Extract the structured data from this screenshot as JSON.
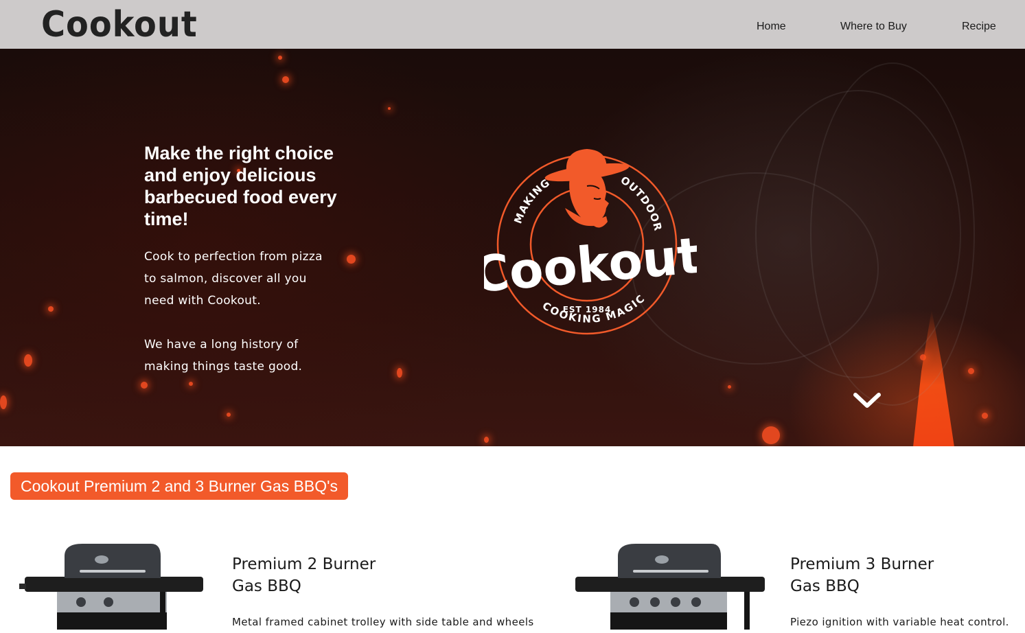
{
  "header": {
    "brand": "Cookout",
    "nav": [
      {
        "label": "Home"
      },
      {
        "label": "Where to Buy"
      },
      {
        "label": "Recipe"
      }
    ]
  },
  "hero": {
    "heading": "Make the right choice and enjoy delicious barbecued food every time!",
    "paragraph_1": "Cook to perfection from pizza to salmon, discover all you need with Cookout.",
    "paragraph_2": "We have a long history of making things taste good.",
    "logo": {
      "wordmark": "Cookout",
      "arc_left": "MAKING",
      "arc_right": "OUTDOOR",
      "established": "EST 1984",
      "arc_bottom": "COOKING MAGIC"
    },
    "scroll_icon": "chevron-down-icon"
  },
  "products_section": {
    "badge": "Cookout Premium 2 and 3 Burner Gas BBQ's",
    "items": [
      {
        "title_line_1": "Premium 2 Burner",
        "title_line_2": "Gas BBQ",
        "description": "Metal framed cabinet trolley with side table and wheels"
      },
      {
        "title_line_1": "Premium 3 Burner",
        "title_line_2": "Gas BBQ",
        "description": "Piezo ignition with variable heat control."
      }
    ]
  },
  "colors": {
    "header_bg": "#cdcaca",
    "accent_orange": "#f25a2a",
    "hero_dark": "#1a0c0a",
    "text_dark": "#1a1a1a"
  }
}
